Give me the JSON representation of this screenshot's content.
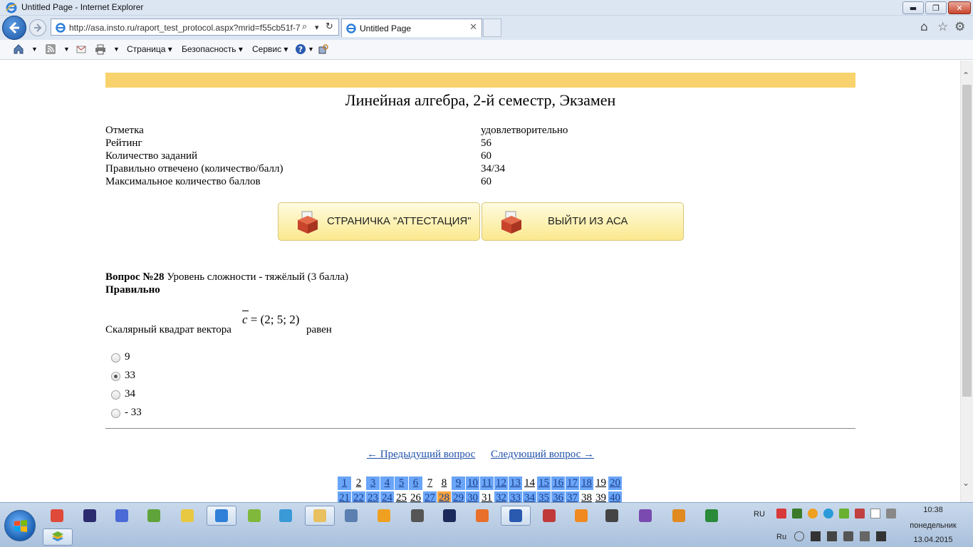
{
  "window": {
    "title": "Untitled Page - Internet Explorer",
    "min_glyph": "▬",
    "max_glyph": "❐",
    "close_glyph": "✕"
  },
  "browser": {
    "url": "http://asa.insto.ru/raport_test_protocol.aspx?mrid=f55cb51f-7",
    "tab_title": "Untitled Page",
    "tab_close": "✕",
    "search_glyph": "⌕",
    "dropdown_glyph": "▾",
    "refresh_glyph": "↻",
    "home_glyph": "⌂",
    "favorites_glyph": "☆",
    "settings_glyph": "⚙"
  },
  "command_bar": {
    "page_menu": "Страница ▾",
    "safety_menu": "Безопасность ▾",
    "tools_menu": "Сервис ▾"
  },
  "colors": {
    "banner": "#f8d36d",
    "pager_blue": "#6aa5f8",
    "pager_orange": "#f5a340",
    "link": "#1f4fa8"
  },
  "exam": {
    "title": "Линейная алгебра, 2-й семестр, Экзамен",
    "info": [
      {
        "label": "Отметка",
        "value": "удовлетворительно"
      },
      {
        "label": "Рейтинг",
        "value": "56"
      },
      {
        "label": "Количество заданий",
        "value": "60"
      },
      {
        "label": "Правильно отвечено (количество/балл)",
        "value": "34/34"
      },
      {
        "label": "Максимальное количество баллов",
        "value": "60"
      }
    ]
  },
  "buttons": {
    "attestation": "СТРАНИЧКА \"АТТЕСТАЦИЯ\"",
    "exit": "ВЫЙТИ ИЗ АСА"
  },
  "question": {
    "number_label": "Вопрос №28",
    "difficulty": " Уровень сложности - тяжёлый (3 балла)",
    "status": "Правильно",
    "text_before": "Скалярный квадрат вектора",
    "formula_var": "c",
    "formula_rest": " = (2; 5; 2)",
    "text_after": "равен",
    "options": [
      {
        "label": "9",
        "selected": false
      },
      {
        "label": "33",
        "selected": true
      },
      {
        "label": "34",
        "selected": false
      },
      {
        "label": "- 33",
        "selected": false
      }
    ]
  },
  "navigation": {
    "prev": "← Предыдущий вопрос",
    "next": "Следующий вопрос →"
  },
  "pager": {
    "row1": [
      {
        "n": "1",
        "state": "answered"
      },
      {
        "n": "2",
        "state": "plain"
      },
      {
        "n": "3",
        "state": "answered"
      },
      {
        "n": "4",
        "state": "answered"
      },
      {
        "n": "5",
        "state": "answered"
      },
      {
        "n": "6",
        "state": "answered"
      },
      {
        "n": "7",
        "state": "plain"
      },
      {
        "n": "8",
        "state": "plain"
      },
      {
        "n": "9",
        "state": "answered"
      },
      {
        "n": "10",
        "state": "answered"
      },
      {
        "n": "11",
        "state": "answered"
      },
      {
        "n": "12",
        "state": "answered"
      },
      {
        "n": "13",
        "state": "answered"
      },
      {
        "n": "14",
        "state": "plain"
      },
      {
        "n": "15",
        "state": "answered"
      },
      {
        "n": "16",
        "state": "answered"
      },
      {
        "n": "17",
        "state": "answered"
      },
      {
        "n": "18",
        "state": "answered"
      },
      {
        "n": "19",
        "state": "plain"
      },
      {
        "n": "20",
        "state": "answered"
      }
    ],
    "row2": [
      {
        "n": "21",
        "state": "answered"
      },
      {
        "n": "22",
        "state": "answered"
      },
      {
        "n": "23",
        "state": "answered"
      },
      {
        "n": "24",
        "state": "answered"
      },
      {
        "n": "25",
        "state": "plain"
      },
      {
        "n": "26",
        "state": "plain"
      },
      {
        "n": "27",
        "state": "answered"
      },
      {
        "n": "28",
        "state": "current"
      },
      {
        "n": "29",
        "state": "answered"
      },
      {
        "n": "30",
        "state": "answered"
      },
      {
        "n": "31",
        "state": "plain"
      },
      {
        "n": "32",
        "state": "answered"
      },
      {
        "n": "33",
        "state": "answered"
      },
      {
        "n": "34",
        "state": "answered"
      },
      {
        "n": "35",
        "state": "answered"
      },
      {
        "n": "36",
        "state": "answered"
      },
      {
        "n": "37",
        "state": "answered"
      },
      {
        "n": "38",
        "state": "plain"
      },
      {
        "n": "39",
        "state": "plain"
      },
      {
        "n": "40",
        "state": "answered"
      }
    ]
  },
  "taskbar": {
    "lang_top": "RU",
    "lang_bottom": "Ru",
    "time": "10:38",
    "day": "понедельник",
    "date": "13.04.2015",
    "apps": [
      {
        "name": "chrome-icon",
        "color": "#e04a3a"
      },
      {
        "name": "media-player-icon",
        "color": "#2b2b70"
      },
      {
        "name": "daemon-tools-icon",
        "color": "#4a6ad6"
      },
      {
        "name": "android-tool-icon",
        "color": "#5fa43a"
      },
      {
        "name": "notes-icon",
        "color": "#e8c840"
      },
      {
        "name": "internet-explorer-icon",
        "color": "#2f7fd8"
      },
      {
        "name": "wifi-icon",
        "color": "#7fb83a"
      },
      {
        "name": "display-icon",
        "color": "#3a9ad8"
      },
      {
        "name": "explorer-folder-icon",
        "color": "#e8c060"
      },
      {
        "name": "sound-icon",
        "color": "#5a7fb0"
      },
      {
        "name": "avast-icon",
        "color": "#f0a020"
      },
      {
        "name": "camera-icon",
        "color": "#555555"
      },
      {
        "name": "photoshop-icon",
        "color": "#1a2a5a"
      },
      {
        "name": "firefox-icon",
        "color": "#e8702a"
      },
      {
        "name": "word-icon",
        "color": "#2a5ab0"
      },
      {
        "name": "calendar-icon",
        "color": "#c03a3a"
      },
      {
        "name": "qip-icon",
        "color": "#f08a20"
      },
      {
        "name": "grid-icon",
        "color": "#444444"
      },
      {
        "name": "visual-studio-icon",
        "color": "#7a4ab0"
      },
      {
        "name": "media-play-icon",
        "color": "#e08a20"
      },
      {
        "name": "excel-icon",
        "color": "#2a8a3a"
      }
    ]
  }
}
